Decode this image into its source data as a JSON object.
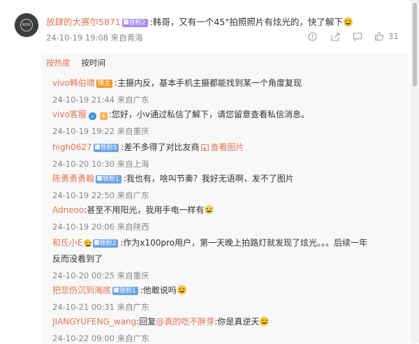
{
  "main_comment": {
    "username": "放肆的大赛尔5871",
    "badge": "铁粉2",
    "text": ":韩哥，又有一个45°拍照照片有炫光的，快了解下",
    "emoji": "laughing-emoji",
    "timestamp": "24-10-19 19:08",
    "location": "来自青海",
    "like_count": "31",
    "avatar_text": "ROG"
  },
  "tabs": [
    {
      "label": "按热度"
    },
    {
      "label": "按时间"
    }
  ],
  "replies": [
    {
      "username": "vivo韩伯啸",
      "badge": "博主",
      "text": ":主摄内反，基本手机主摄都能找到某一个角度复现",
      "timestamp": "24-10-19 21:44",
      "location": "来自广东"
    },
    {
      "username": "vivo客服",
      "text": ":您好，小v通过私信了解下，请您留意查看私信消息。",
      "timestamp": "24-10-19 19:22",
      "location": "来自重庆"
    },
    {
      "username": "high0627",
      "badge": "铁粉5",
      "text": ":差不多得了对比友商",
      "link": "查看图片",
      "timestamp": "24-10-20 10:30",
      "location": "来自上海"
    },
    {
      "username": "陈勇勇勇翰",
      "badge": "铁粉1",
      "text": ":我也有，啥叫节奏？我好无语啊，发不了图片",
      "timestamp": "24-10-19 22:50",
      "location": "来自广东"
    },
    {
      "username": "Adneoo",
      "text": ":甚至不用阳光，我用手电一样有",
      "timestamp": "24-10-19 20:06",
      "location": "来自陕西"
    },
    {
      "username": "和氏小E",
      "badge": "铁粉2",
      "text": ":作为x100pro用户，第一天晚上拍路灯就发现了炫光。。。后续一年",
      "text2": "反而没看到了",
      "timestamp": "24-10-20 00:25",
      "location": "来自重庆"
    },
    {
      "username": "把悲伤沉到海底",
      "badge": "铁粉1",
      "text": ":他敢说吗",
      "timestamp": "24-10-21 00:31",
      "location": "来自广东"
    },
    {
      "username": "JIANGYUFENG_wang",
      "text_pre": ":回复",
      "mention": "@真的吃不胖芽",
      "text": ":你是真逆天",
      "timestamp": "24-10-22 09:00",
      "location": "来自广东"
    }
  ]
}
